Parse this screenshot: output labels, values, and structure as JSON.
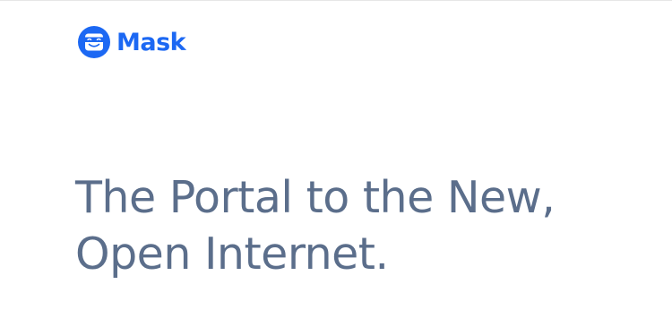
{
  "header": {
    "logo_icon": "mask-logo-icon",
    "brand_name": "Mask",
    "brand_color": "#1c68f3"
  },
  "hero": {
    "line1": "The Portal to the New,",
    "line2": "Open Internet.",
    "text_color": "#5b6e8b"
  }
}
